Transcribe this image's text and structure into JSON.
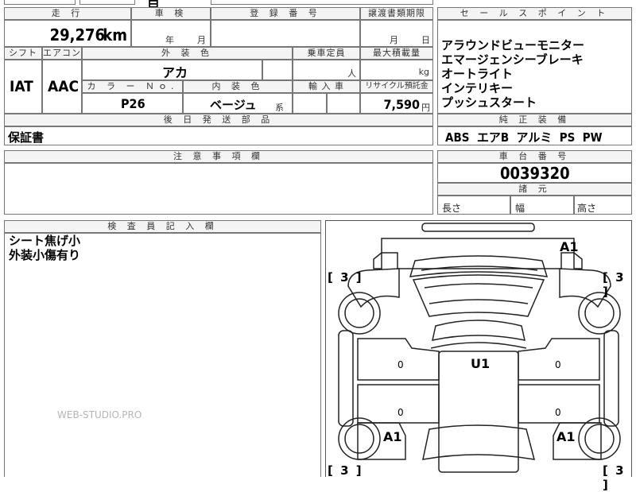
{
  "top_strip_fragment": "目",
  "mileage": {
    "header": "走 行",
    "value": "29,276",
    "unit": "km"
  },
  "inspection": {
    "header": "車 検",
    "year_unit": "年",
    "month_unit": "月"
  },
  "registration": {
    "header": "登 録 番 号",
    "value": ""
  },
  "transfer": {
    "header": "譲渡書類期限",
    "month_unit": "月",
    "day_unit": "日"
  },
  "shift": {
    "header": "シフト",
    "value": "IAT"
  },
  "aircon": {
    "header": "エアコン",
    "value": "AAC"
  },
  "exterior_color": {
    "header": "外 装 色",
    "value": "アカ"
  },
  "capacity": {
    "header": "乗車定員",
    "unit": "人"
  },
  "max_load": {
    "header": "最大積載量",
    "unit": "kg"
  },
  "color_no": {
    "header": "カ ラ ー Ｎｏ.",
    "value": "P26"
  },
  "interior_color": {
    "header": "内 装 色",
    "value": "ベージュ",
    "suffix": "系"
  },
  "import": {
    "header": "輸 入 車"
  },
  "recycle": {
    "header": "リサイクル預託金",
    "value": "7,590",
    "unit": "円"
  },
  "sales_points": {
    "header": "セ ー ル ス ポ イ ン ト",
    "items": [
      "アラウンドビューモニター",
      "エマージェンシーブレーキ",
      "オートライト",
      "インテリキー",
      "プッシュスタート"
    ]
  },
  "shipping": {
    "header": "後 日 発 送 部 品",
    "value": "保証書"
  },
  "equipment": {
    "header": "純 正 装 備",
    "value": "ABS  エアB  アルミ  PS  PW"
  },
  "notes": {
    "header": "注 意 事 項 欄"
  },
  "chassis": {
    "header": "車 台 番 号",
    "value": "0039320"
  },
  "dimensions": {
    "header": "諸 元",
    "length": "長さ",
    "width": "幅",
    "height": "高さ"
  },
  "inspector": {
    "header": "検 査 員 記 入 欄",
    "notes": [
      "シート焦げ小",
      "外装小傷有り"
    ]
  },
  "diagram": {
    "marks": {
      "roof": "U1",
      "front_right": "A1",
      "rear_left": "A1",
      "rear_right": "A1",
      "door_zero": "0"
    },
    "bracket_value": "[ 3 ]"
  },
  "watermark": "WEB-STUDIO.PRO"
}
